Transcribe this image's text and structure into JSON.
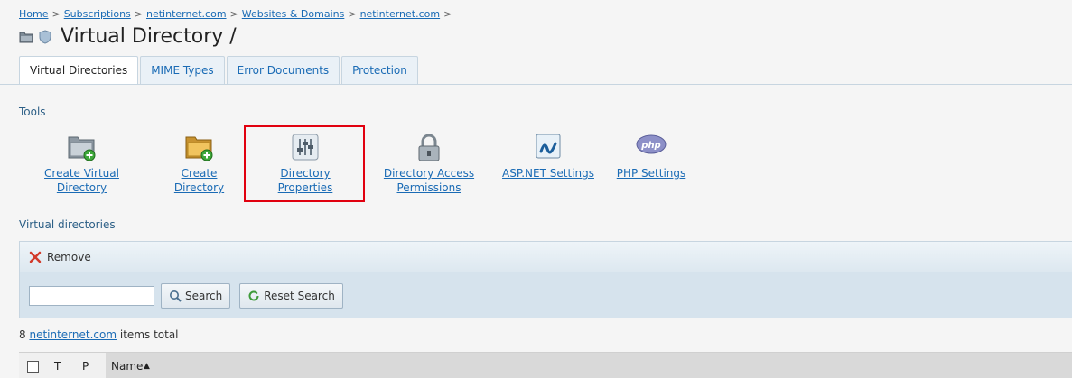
{
  "breadcrumb": {
    "items": [
      "Home",
      "Subscriptions",
      "netinternet.com",
      "Websites & Domains",
      "netinternet.com"
    ],
    "separator": ">"
  },
  "page": {
    "title": "Virtual Directory /",
    "folder_icon": "folder-icon",
    "shield_icon": "shield-icon"
  },
  "tabs": [
    {
      "label": "Virtual Directories",
      "active": true
    },
    {
      "label": "MIME Types",
      "active": false
    },
    {
      "label": "Error Documents",
      "active": false
    },
    {
      "label": "Protection",
      "active": false
    }
  ],
  "tools": {
    "heading": "Tools",
    "items": [
      {
        "label": "Create Virtual Directory",
        "icon": "folder-add-icon"
      },
      {
        "label": "Create Directory",
        "icon": "folder-add-icon"
      },
      {
        "label": "Directory Properties",
        "icon": "sliders-icon",
        "highlighted": true
      },
      {
        "label_line1": "Directory Access",
        "label_line2": "Permissions",
        "icon": "lock-icon"
      },
      {
        "label": "ASP.NET Settings",
        "icon": "aspnet-icon"
      },
      {
        "label": "PHP Settings",
        "icon": "php-icon",
        "icon_text": "php"
      }
    ]
  },
  "vdirs": {
    "heading": "Virtual directories",
    "remove_label": "Remove",
    "search_value": "",
    "search_button": "Search",
    "reset_button": "Reset Search",
    "total_count": "8",
    "total_link": "netinternet.com",
    "total_suffix": "items total",
    "columns": {
      "t": "T",
      "p": "P",
      "name": "Name",
      "sort": "▲"
    }
  },
  "colors": {
    "accent": "#1a6bb5",
    "highlight": "#e1000f",
    "panel": "#d6e3ed"
  }
}
